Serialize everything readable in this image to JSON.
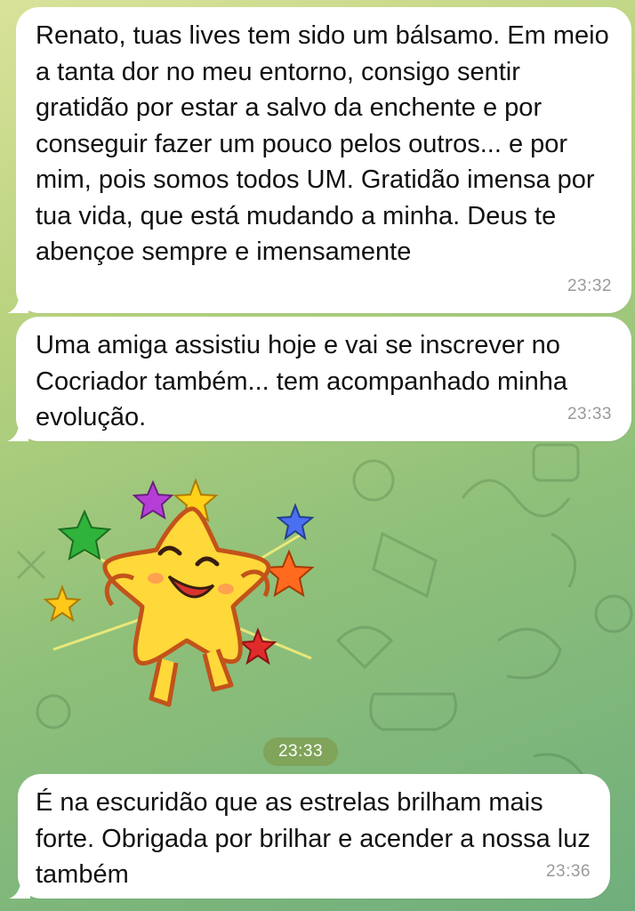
{
  "messages": [
    {
      "text": "Renato, tuas lives tem sido um bálsamo. Em meio a tanta dor no meu entorno, consigo sentir gratidão por estar a salvo da enchente e por conseguir fazer um pouco pelos outros... e por mim, pois somos todos UM. Gratidão imensa por tua vida, que está mudando a minha. Deus te abençoe sempre e imensamente",
      "time": "23:32"
    },
    {
      "text": "Uma amiga assistiu hoje e vai se inscrever no Cocriador também... tem acompanhado minha evolução.",
      "time": "23:33"
    },
    {
      "text": "É na escuridão que as estrelas brilham mais forte. Obrigada por brilhar e acender a nossa luz também",
      "time": "23:36"
    }
  ],
  "sticker": {
    "icon": "happy-star-sticker-icon",
    "time": "23:33"
  },
  "colors": {
    "bubble": "#ffffff",
    "time_text": "#9a9a9a",
    "sticker_time_badge": "#7fa45a",
    "wallpaper_top": "#d9e29a",
    "wallpaper_bottom": "#6fae7c"
  }
}
